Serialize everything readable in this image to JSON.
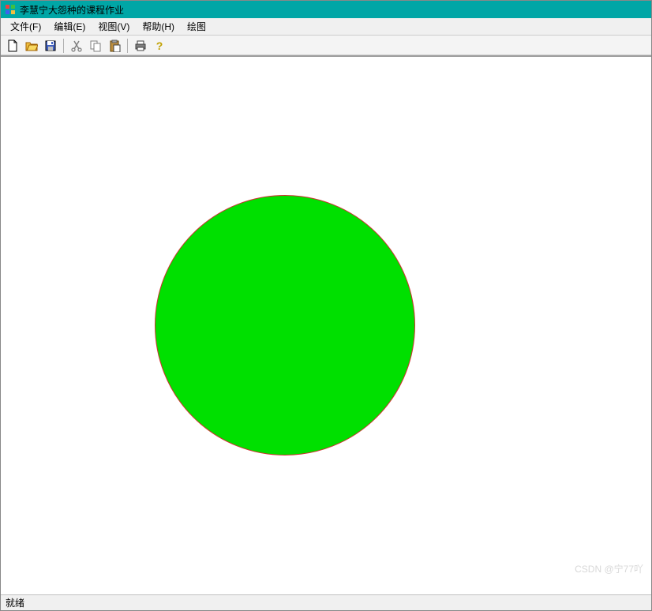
{
  "window": {
    "title": "李慧宁大怨种的课程作业"
  },
  "menu": {
    "file": "文件(F)",
    "edit": "编辑(E)",
    "view": "视图(V)",
    "help": "帮助(H)",
    "draw": "绘图"
  },
  "toolbar": {
    "new_icon": "new",
    "open_icon": "open",
    "save_icon": "save",
    "cut_icon": "cut",
    "copy_icon": "copy",
    "paste_icon": "paste",
    "print_icon": "print",
    "help_icon": "help"
  },
  "canvas": {
    "shape": "circle",
    "fill_color": "#00e000",
    "stroke_color": "#d03030"
  },
  "statusbar": {
    "text": "就绪"
  },
  "watermark": "CSDN @宁77吖"
}
